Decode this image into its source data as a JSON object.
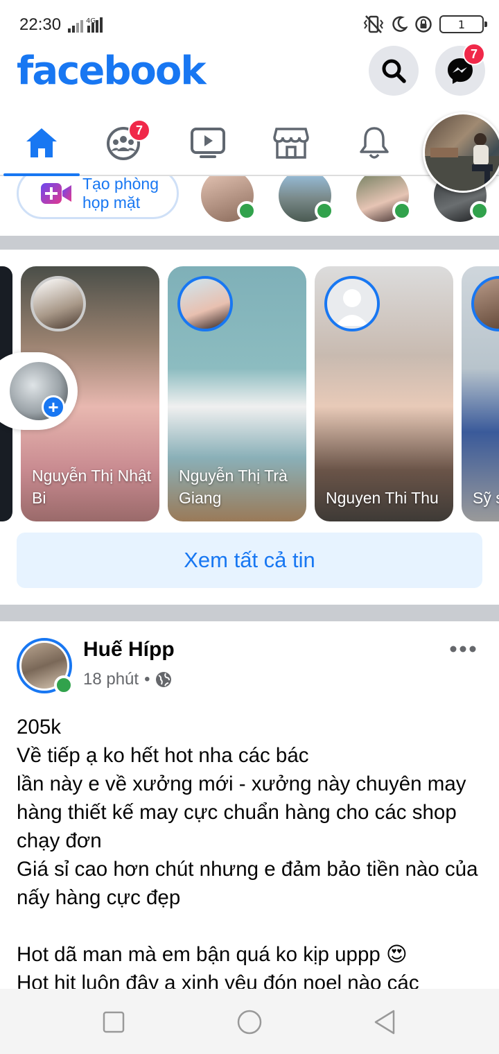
{
  "status_bar": {
    "time": "22:30",
    "network": "4G",
    "battery": "1"
  },
  "header": {
    "logo": "facebook",
    "messenger_badge": "7"
  },
  "nav": {
    "groups_badge": "7",
    "tabs": [
      "home-icon",
      "groups-icon",
      "watch-icon",
      "marketplace-icon",
      "notifications-icon",
      "profile"
    ]
  },
  "rooms": {
    "create_label": "Tạo phòng họp mặt"
  },
  "stories": {
    "items": [
      {
        "name": "Nguyễn Thị Nhật Bi"
      },
      {
        "name": "Nguyễn Thị Trà Giang"
      },
      {
        "name": "Nguyen Thi Thu"
      },
      {
        "name": "Sỹ s"
      }
    ],
    "see_all": "Xem tất cả tin"
  },
  "post": {
    "author": "Huế Hípp",
    "time": "18 phút",
    "separator": "•",
    "lines": [
      "205k",
      "Về tiếp ạ ko hết hot nha các bác",
      "lần này e về xưởng mới - xưởng này chuyên may hàng thiết kế may cực chuẩn hàng cho các shop chạy đơn",
      "Giá sỉ cao hơn chút nhưng e đảm bảo tiền nào của nấy hàng cực đẹp",
      "Hot dã man mà em bận quá ko kịp uppp 😍",
      "Hot hit luôn đây ạ xinh yêu đón noel nào các"
    ]
  },
  "colors": {
    "brand": "#1877f2",
    "online": "#31a24c",
    "badge": "#f02849"
  }
}
